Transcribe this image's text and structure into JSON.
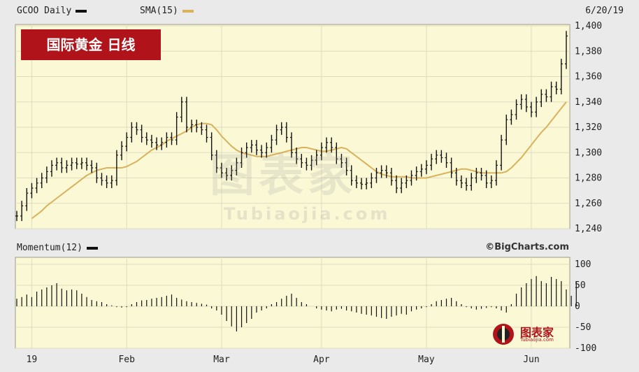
{
  "header": {
    "symbol": "GCOO Daily",
    "sma_label": "SMA(15)",
    "date": "6/20/19"
  },
  "badge": {
    "label": "国际黄金  日线"
  },
  "credit": {
    "label": "©BigCharts.com"
  },
  "momentum": {
    "label": "Momentum(12)"
  },
  "watermark": {
    "main": "图表家",
    "sub": "Tubiaojia.com"
  },
  "logo": {
    "text": "图表家",
    "sub": "Tubiaojia.com"
  },
  "colors": {
    "plot_bg": "#fbf8d6",
    "price_bar": "#111111",
    "sma": "#d8b25c",
    "badge": "#b0141a",
    "grid": "#dfdcc0"
  },
  "chart_data": [
    {
      "type": "line",
      "name": "price",
      "ylim": [
        1240,
        1400
      ],
      "yticks": [
        "1,400",
        "1,380",
        "1,360",
        "1,340",
        "1,320",
        "1,300",
        "1,280",
        "1,260",
        "1,240"
      ],
      "ytick_values": [
        1400,
        1380,
        1360,
        1340,
        1320,
        1300,
        1280,
        1260,
        1240
      ],
      "xlabels": [
        "19",
        "Feb",
        "Mar",
        "Apr",
        "May",
        "Jun"
      ],
      "xlabel_index": [
        3,
        22,
        41,
        61,
        82,
        103
      ],
      "grid": true,
      "series": [
        {
          "values": [
            1250,
            1258,
            1268,
            1272,
            1276,
            1280,
            1285,
            1290,
            1292,
            1288,
            1290,
            1292,
            1291,
            1292,
            1290,
            1288,
            1280,
            1278,
            1276,
            1278,
            1298,
            1305,
            1312,
            1320,
            1318,
            1312,
            1310,
            1308,
            1306,
            1308,
            1312,
            1310,
            1328,
            1340,
            1320,
            1322,
            1320,
            1318,
            1312,
            1298,
            1288,
            1284,
            1282,
            1286,
            1292,
            1300,
            1304,
            1306,
            1302,
            1300,
            1304,
            1310,
            1318,
            1320,
            1312,
            1300,
            1295,
            1292,
            1290,
            1294,
            1298,
            1304,
            1308,
            1304,
            1295,
            1292,
            1286,
            1278,
            1276,
            1275,
            1276,
            1280,
            1284,
            1286,
            1284,
            1278,
            1272,
            1276,
            1278,
            1282,
            1285,
            1287,
            1290,
            1295,
            1298,
            1296,
            1292,
            1284,
            1278,
            1276,
            1274,
            1280,
            1284,
            1282,
            1276,
            1278,
            1290,
            1310,
            1326,
            1330,
            1338,
            1342,
            1336,
            1332,
            1340,
            1346,
            1344,
            1352,
            1350,
            1370,
            1392
          ]
        },
        {
          "values": [
            1248,
            1251,
            1254,
            1258,
            1261,
            1264,
            1267,
            1270,
            1273,
            1276,
            1279,
            1282,
            1284,
            1286,
            1287,
            1288,
            1288,
            1288,
            1288,
            1289,
            1291,
            1293,
            1296,
            1299,
            1302,
            1304,
            1306,
            1309,
            1311,
            1313,
            1315,
            1317,
            1320,
            1322,
            1323,
            1323,
            1322,
            1318,
            1313,
            1309,
            1305,
            1302,
            1300,
            1299,
            1298,
            1297,
            1297,
            1297,
            1298,
            1299,
            1300,
            1301,
            1302,
            1303,
            1304,
            1304,
            1303,
            1302,
            1301,
            1301,
            1302,
            1303,
            1304,
            1303,
            1300,
            1297,
            1294,
            1291,
            1288,
            1285,
            1283,
            1282,
            1281,
            1281,
            1281,
            1281,
            1280,
            1280,
            1280,
            1280,
            1281,
            1282,
            1283,
            1284,
            1285,
            1286,
            1287,
            1287,
            1286,
            1285,
            1284,
            1284,
            1284,
            1284,
            1284,
            1285,
            1288,
            1292,
            1296,
            1301,
            1306,
            1311,
            1316,
            1320,
            1325,
            1330,
            1335,
            1340
          ]
        }
      ]
    },
    {
      "type": "bar",
      "name": "momentum",
      "ylim": [
        -100,
        100
      ],
      "yticks": [
        "100",
        "50",
        "0",
        "-50",
        "-100"
      ],
      "ytick_values": [
        100,
        50,
        0,
        -50,
        -100
      ],
      "values": [
        18,
        22,
        28,
        22,
        35,
        40,
        45,
        50,
        55,
        42,
        38,
        40,
        38,
        30,
        22,
        15,
        12,
        10,
        5,
        2,
        -2,
        -3,
        -2,
        5,
        10,
        14,
        15,
        18,
        20,
        22,
        25,
        28,
        20,
        16,
        12,
        10,
        8,
        6,
        4,
        -5,
        -10,
        -20,
        -35,
        -48,
        -60,
        -50,
        -40,
        -30,
        -15,
        -10,
        -5,
        5,
        10,
        18,
        25,
        30,
        20,
        10,
        5,
        0,
        -5,
        -8,
        -10,
        -12,
        -8,
        -6,
        -10,
        -12,
        -15,
        -18,
        -20,
        -22,
        -25,
        -28,
        -30,
        -25,
        -22,
        -18,
        -20,
        -12,
        -8,
        -5,
        -2,
        5,
        12,
        15,
        18,
        20,
        12,
        5,
        -2,
        -5,
        -8,
        -6,
        -4,
        -2,
        -5,
        -10,
        -15,
        5,
        30,
        45,
        55,
        65,
        72,
        60,
        55,
        70,
        65,
        60,
        40,
        25,
        60
      ]
    }
  ]
}
